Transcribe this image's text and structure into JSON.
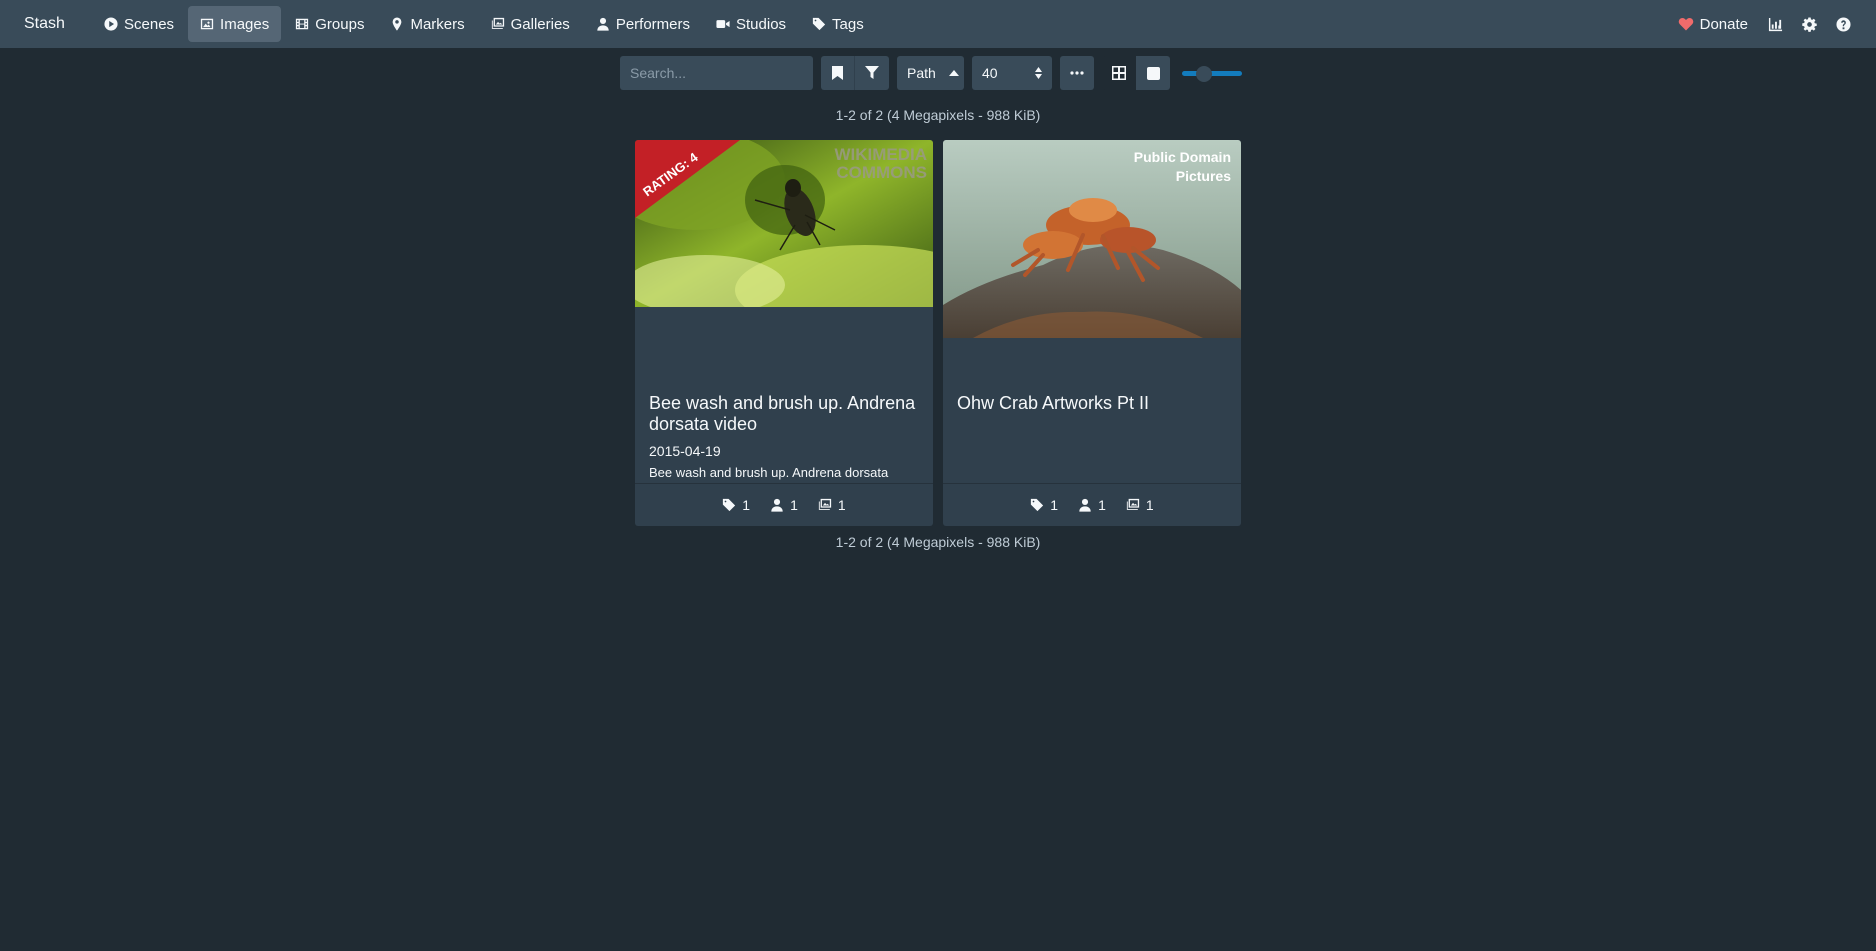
{
  "nav": {
    "brand": "Stash",
    "items": [
      {
        "label": "Scenes",
        "icon": "play-circle-icon"
      },
      {
        "label": "Images",
        "icon": "image-icon"
      },
      {
        "label": "Groups",
        "icon": "film-icon"
      },
      {
        "label": "Markers",
        "icon": "map-marker-icon"
      },
      {
        "label": "Galleries",
        "icon": "images-icon"
      },
      {
        "label": "Performers",
        "icon": "user-icon"
      },
      {
        "label": "Studios",
        "icon": "video-icon"
      },
      {
        "label": "Tags",
        "icon": "tag-icon"
      }
    ],
    "active": "Images",
    "donate_label": "Donate"
  },
  "toolbar": {
    "search_placeholder": "Search...",
    "sort_by": "Path",
    "per_page": "40"
  },
  "results": {
    "summary_top": "1-2 of 2 (4 Megapixels - 988 KiB)",
    "summary_bottom": "1-2 of 2 (4 Megapixels - 988 KiB)"
  },
  "cards": [
    {
      "title": "Bee wash and brush up. Andrena dorsata video",
      "date": "2015-04-19",
      "details": "Bee wash and brush up. Andrena dorsata",
      "rating_banner": "RATING: 4",
      "watermark": "WIKIMEDIA COMMONS",
      "tag_count": "1",
      "performer_count": "1",
      "gallery_count": "1"
    },
    {
      "title": "Ohw Crab Artworks Pt II",
      "watermark": "Public Domain Pictures",
      "tag_count": "1",
      "performer_count": "1",
      "gallery_count": "1"
    }
  ],
  "colors": {
    "background": "#202b33",
    "navbar": "#394b59",
    "card": "#30404d",
    "accent": "#137cbd",
    "rating_banner": "#c32026",
    "heart": "#f06b6b"
  }
}
